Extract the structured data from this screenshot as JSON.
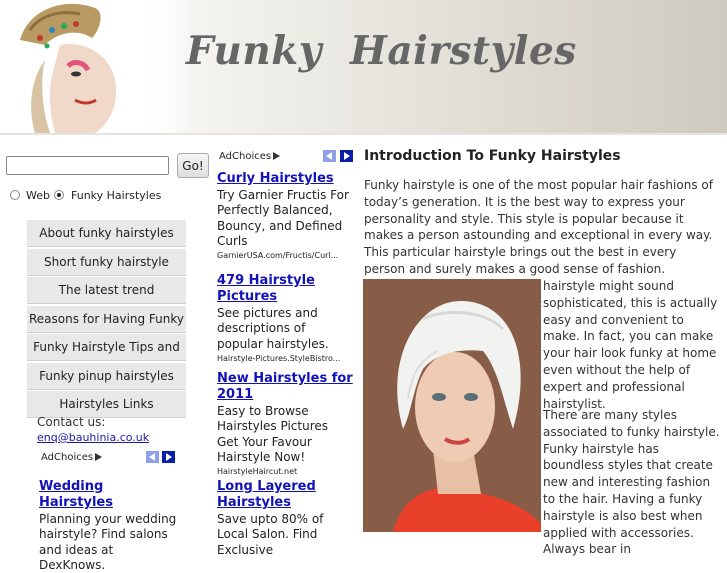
{
  "header": {
    "site_title": "Funky  Hairstyles"
  },
  "search": {
    "input_value": "",
    "go_label": "Go!",
    "options": [
      {
        "label": "Web",
        "selected": false
      },
      {
        "label": "Funky Hairstyles",
        "selected": true
      }
    ]
  },
  "nav": {
    "items": [
      {
        "label": "About funky hairstyles"
      },
      {
        "label": "Short funky hairstyle"
      },
      {
        "label": "The latest trend"
      },
      {
        "label": "Reasons for Having Funky"
      },
      {
        "label": "Funky Hairstyle Tips and"
      },
      {
        "label": "Funky pinup hairstyles"
      },
      {
        "label": "Hairstyles Links"
      }
    ]
  },
  "contact": {
    "label": "Contact us:",
    "email": "enq@bauhinia.co.uk"
  },
  "ads_column": {
    "adchoices_label": "AdChoices",
    "ads": [
      {
        "title": "Curly Hairstyles",
        "desc": "Try Garnier Fructis For Perfectly Balanced, Bouncy, and Defined Curls",
        "url": "GarnierUSA.com/Fructis/Curl..."
      },
      {
        "title": "479 Hairstyle Pictures",
        "desc": "See pictures and descriptions of popular hairstyles.",
        "url": "Hairstyle-Pictures.StyleBistro..."
      },
      {
        "title": "New Hairstyles for 2011",
        "desc": "Easy to Browse Hairstyles Pictures Get Your Favour Hairstyle Now!",
        "url": "HairstyleHaircut.net"
      },
      {
        "title": "Long Layered Hairstyles",
        "desc": "Save upto 80% of Local Salon. Find Exclusive",
        "url": ""
      }
    ]
  },
  "ads_left": {
    "adchoices_label": "AdChoices",
    "ads": [
      {
        "title": "Wedding Hairstyles",
        "desc": "Planning your wedding hairstyle? Find salons and ideas at DexKnows."
      }
    ]
  },
  "article": {
    "heading": "Introduction To Funky Hairstyles",
    "para1": "Funky hairstyle is one of the most popular hair fashions of today’s generation. It is the best way to express your personality and style. This style is popular because it makes a person astounding and exceptional in every way. This particular hairstyle brings out the best in every person and surely makes a good sense of fashion. Although a funky",
    "para1_cont": "hairstyle might sound sophisticated, this is actually easy and convenient to make. In fact, you can make your hair look funky at home even without the help of expert and professional hairstylist.",
    "para2": "There are many styles associated to funky hairstyle. Funky hairstyle has boundless styles that create new and interesting fashion to the hair. Having a funky hairstyle is also best when applied with accessories. Always bear in"
  },
  "colors": {
    "link": "#1212b8",
    "nav_bg": "#e8e8e8",
    "title": "#666666"
  }
}
